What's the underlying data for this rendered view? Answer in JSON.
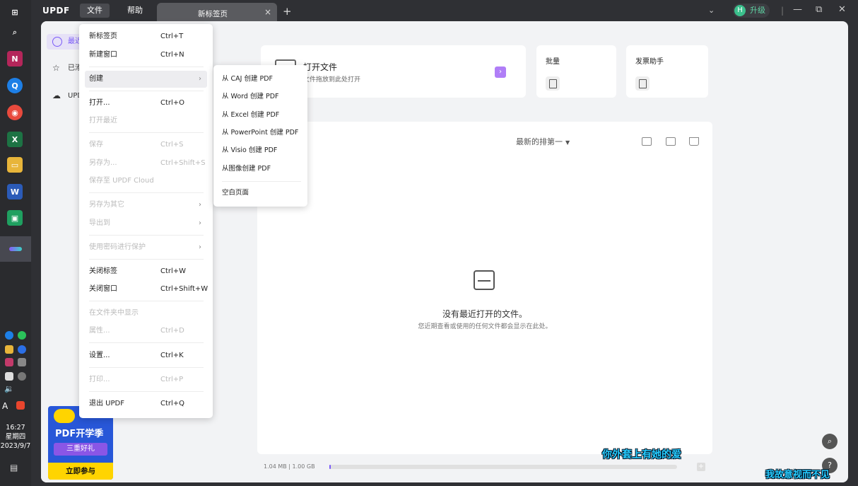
{
  "taskbar": {
    "clock": {
      "time": "16:27",
      "weekday": "星期四",
      "date": "2023/9/7"
    },
    "ime": "A"
  },
  "titlebar": {
    "logo": "UPDF",
    "menus": {
      "file": "文件",
      "help": "帮助"
    },
    "tab": {
      "label": "新标签页",
      "close": "×"
    },
    "add_tab": "+",
    "upgrade": {
      "avatar": "H",
      "label": "升级"
    },
    "controls": {
      "minimize": "—",
      "restore": "⧉",
      "close": "✕",
      "dropdown": "⌄"
    }
  },
  "sidebar": {
    "items": [
      {
        "label": "最近"
      },
      {
        "label": "已添"
      },
      {
        "label": "UPD"
      }
    ],
    "promo": {
      "line1": "PDF开学季",
      "line2": "三重好礼",
      "cta": "立即参与"
    }
  },
  "cards": {
    "open": {
      "title": "打开文件",
      "subtitle": "文件拖放到此处打开",
      "arrow": "›"
    },
    "batch": {
      "title": "批量"
    },
    "invoice": {
      "title": "发票助手"
    }
  },
  "panel": {
    "sort_label": "最新的排第一",
    "empty_title": "没有最近打开的文件。",
    "empty_subtitle": "您近期查看或使用的任何文件都会显示在此处。",
    "storage": "1.04 MB | 1.00 GB",
    "storage_fraction": 0.001
  },
  "file_menu": {
    "items": [
      {
        "label": "新标签页",
        "shortcut": "Ctrl+T"
      },
      {
        "label": "新建窗口",
        "shortcut": "Ctrl+N"
      },
      {
        "label": "创建",
        "shortcut": "",
        "submenu": true
      },
      {
        "label": "打开...",
        "shortcut": "Ctrl+O"
      },
      {
        "label": "打开最近",
        "shortcut": "",
        "disabled": true
      },
      {
        "label": "保存",
        "shortcut": "Ctrl+S",
        "disabled": true
      },
      {
        "label": "另存为...",
        "shortcut": "Ctrl+Shift+S",
        "disabled": true
      },
      {
        "label": "保存至 UPDF Cloud",
        "shortcut": "",
        "disabled": true
      },
      {
        "label": "另存为其它",
        "shortcut": "",
        "disabled": true,
        "submenu": true
      },
      {
        "label": "导出到",
        "shortcut": "",
        "disabled": true,
        "submenu": true
      },
      {
        "label": "使用密码进行保护",
        "shortcut": "",
        "disabled": true,
        "submenu": true
      },
      {
        "label": "关闭标签",
        "shortcut": "Ctrl+W"
      },
      {
        "label": "关闭窗口",
        "shortcut": "Ctrl+Shift+W"
      },
      {
        "label": "在文件夹中显示",
        "shortcut": "",
        "disabled": true
      },
      {
        "label": "属性...",
        "shortcut": "Ctrl+D",
        "disabled": true
      },
      {
        "label": "设置...",
        "shortcut": "Ctrl+K"
      },
      {
        "label": "打印...",
        "shortcut": "Ctrl+P",
        "disabled": true
      },
      {
        "label": "退出 UPDF",
        "shortcut": "Ctrl+Q"
      }
    ]
  },
  "create_submenu": {
    "items": [
      {
        "label": "从 CAJ 创建 PDF"
      },
      {
        "label": "从 Word 创建 PDF"
      },
      {
        "label": "从 Excel 创建 PDF"
      },
      {
        "label": "从 PowerPoint 创建 PDF"
      },
      {
        "label": "从 Visio 创建 PDF"
      },
      {
        "label": "从图像创建 PDF"
      },
      {
        "label": "空白页面"
      }
    ]
  },
  "captions": {
    "line1": "你外套上有她的爱",
    "line2": "我故意视而不见"
  },
  "colors": {
    "accent": "#7a5af8",
    "upgrade": "#3bbf8c",
    "caption": "#26ccff"
  }
}
